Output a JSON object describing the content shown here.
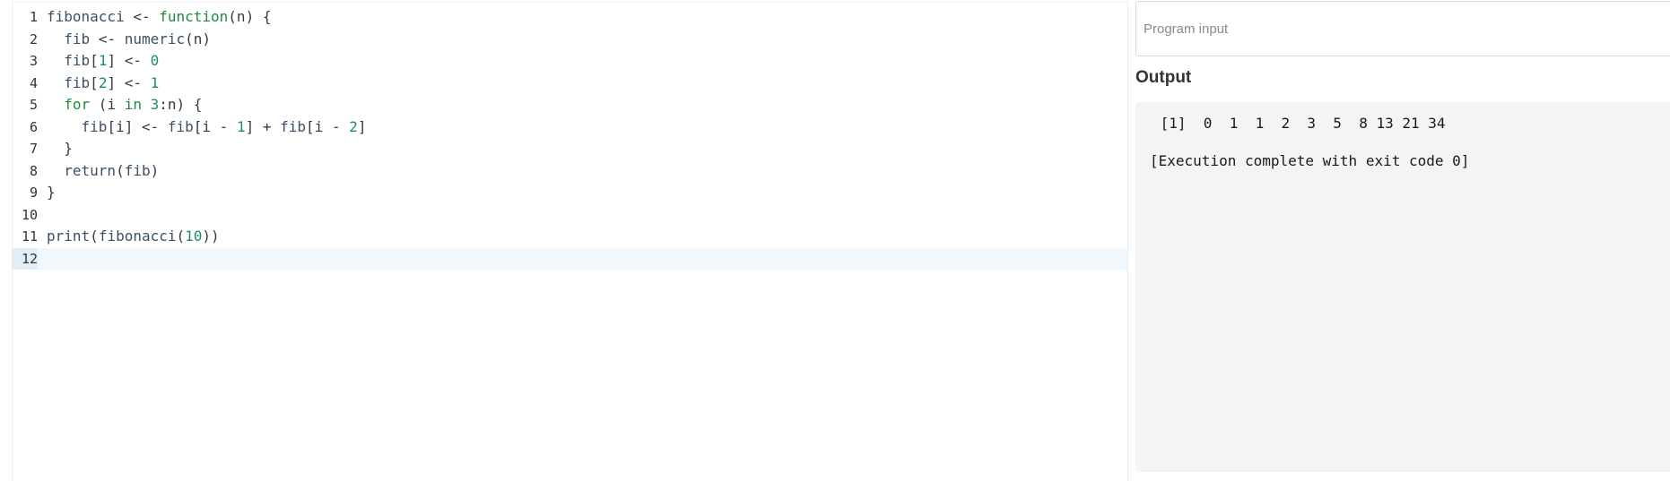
{
  "editor": {
    "lines": [
      {
        "num": "1",
        "tokens": [
          [
            "fibonacci",
            "id"
          ],
          [
            " <- ",
            "plain"
          ],
          [
            "function",
            "kw"
          ],
          [
            "(n) {",
            "plain"
          ]
        ]
      },
      {
        "num": "2",
        "tokens": [
          [
            "  fib",
            "id"
          ],
          [
            " <- ",
            "plain"
          ],
          [
            "numeric",
            "id"
          ],
          [
            "(n)",
            "plain"
          ]
        ]
      },
      {
        "num": "3",
        "tokens": [
          [
            "  fib",
            "id"
          ],
          [
            "[",
            "plain"
          ],
          [
            "1",
            "num"
          ],
          [
            "] <- ",
            "plain"
          ],
          [
            "0",
            "num"
          ]
        ]
      },
      {
        "num": "4",
        "tokens": [
          [
            "  fib",
            "id"
          ],
          [
            "[",
            "plain"
          ],
          [
            "2",
            "num"
          ],
          [
            "] <- ",
            "plain"
          ],
          [
            "1",
            "num"
          ]
        ]
      },
      {
        "num": "5",
        "tokens": [
          [
            "  for",
            "kw"
          ],
          [
            " (i ",
            "plain"
          ],
          [
            "in",
            "kw"
          ],
          [
            " ",
            "plain"
          ],
          [
            "3",
            "num"
          ],
          [
            ":n) {",
            "plain"
          ]
        ]
      },
      {
        "num": "6",
        "tokens": [
          [
            "    fib",
            "id"
          ],
          [
            "[i] <- ",
            "plain"
          ],
          [
            "fib",
            "id"
          ],
          [
            "[i - ",
            "plain"
          ],
          [
            "1",
            "num"
          ],
          [
            "] + ",
            "plain"
          ],
          [
            "fib",
            "id"
          ],
          [
            "[i - ",
            "plain"
          ],
          [
            "2",
            "num"
          ],
          [
            "]",
            "plain"
          ]
        ]
      },
      {
        "num": "7",
        "tokens": [
          [
            "  }",
            "plain"
          ]
        ]
      },
      {
        "num": "8",
        "tokens": [
          [
            "  return",
            "id"
          ],
          [
            "(",
            "plain"
          ],
          [
            "fib",
            "id"
          ],
          [
            ")",
            "plain"
          ]
        ]
      },
      {
        "num": "9",
        "tokens": [
          [
            "}",
            "plain"
          ]
        ]
      },
      {
        "num": "10",
        "tokens": []
      },
      {
        "num": "11",
        "tokens": [
          [
            "print",
            "id"
          ],
          [
            "(",
            "plain"
          ],
          [
            "fibonacci",
            "id"
          ],
          [
            "(",
            "plain"
          ],
          [
            "10",
            "num"
          ],
          [
            "))",
            "plain"
          ]
        ]
      },
      {
        "num": "12",
        "tokens": [],
        "active": true
      }
    ]
  },
  "input": {
    "placeholder": "Program input",
    "value": ""
  },
  "output": {
    "title": "Output",
    "result_line": " [1]  0  1  1  2  3  5  8 13 21 34",
    "status_line": "[Execution complete with exit code 0]"
  }
}
